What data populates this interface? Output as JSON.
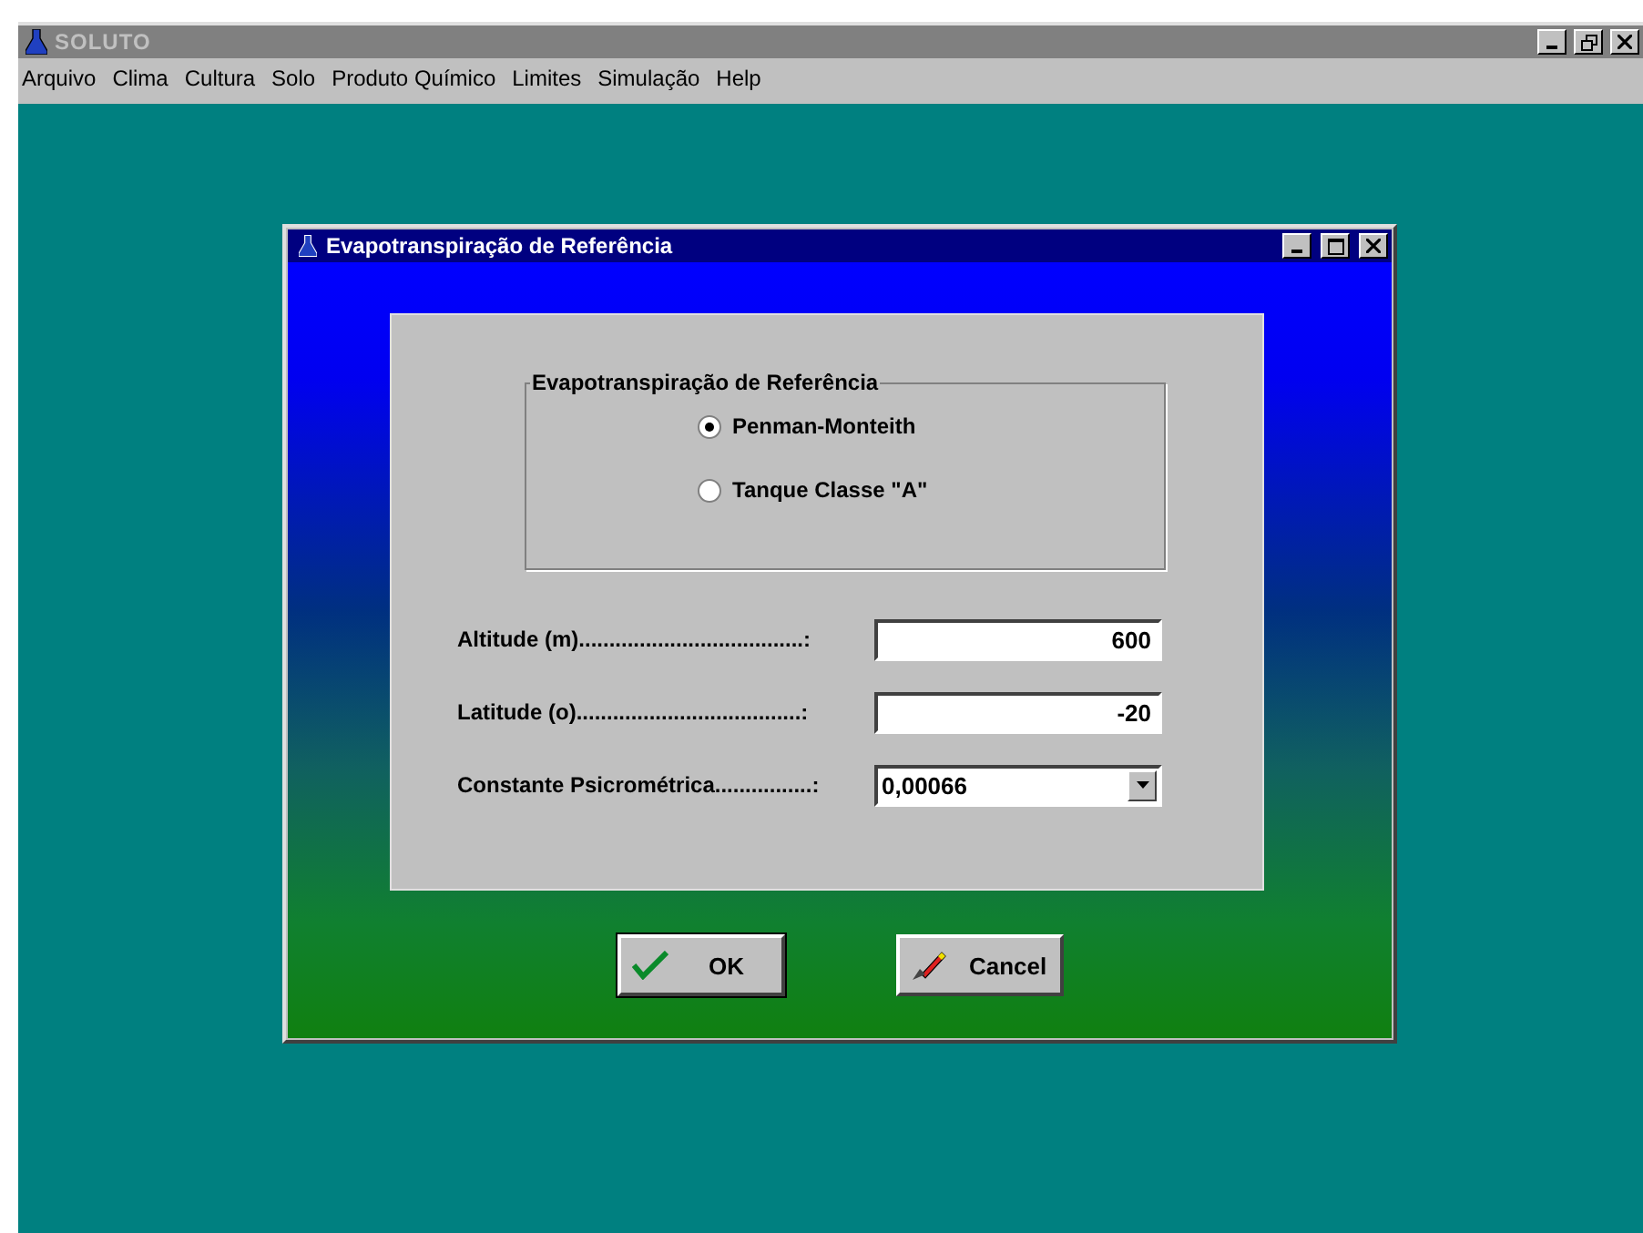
{
  "app_window": {
    "title": "SOLUTO"
  },
  "menu": [
    "Arquivo",
    "Clima",
    "Cultura",
    "Solo",
    "Produto Químico",
    "Limites",
    "Simulação",
    "Help"
  ],
  "dialog": {
    "title": "Evapotranspiração de Referência",
    "group": {
      "label": "Evapotranspiração de Referência",
      "options": [
        {
          "label": "Penman-Monteith",
          "selected": true
        },
        {
          "label": "Tanque Classe \"A\"",
          "selected": false
        }
      ]
    },
    "fields": [
      {
        "kind": "text",
        "label": "Altitude (m).....................................:",
        "value": "600"
      },
      {
        "kind": "text",
        "label": "Latitude (o).....................................:",
        "value": "-20"
      },
      {
        "kind": "dropdown",
        "label": "Constante Psicrométrica................:",
        "value": "0,00066"
      }
    ],
    "buttons": [
      {
        "kind": "ok",
        "label": "OK",
        "default": true
      },
      {
        "kind": "cancel",
        "label": "Cancel",
        "default": false
      }
    ]
  }
}
